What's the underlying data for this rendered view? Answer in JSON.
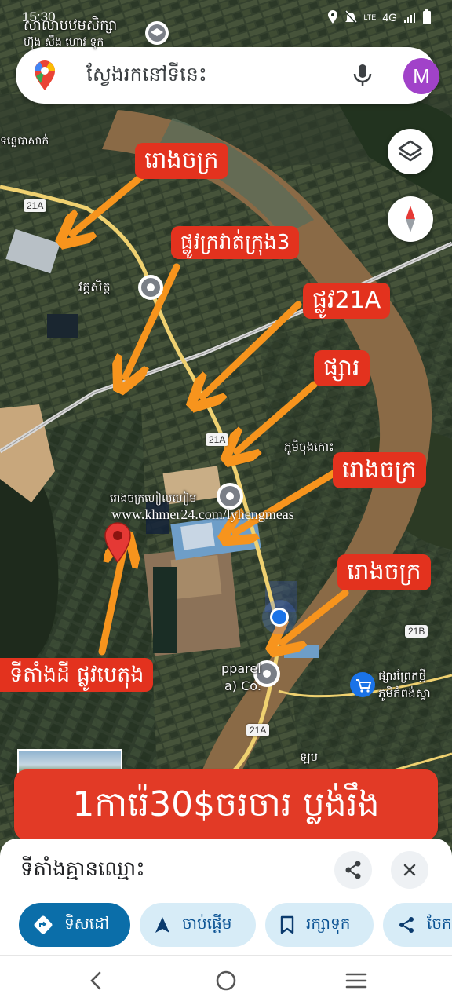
{
  "status_bar": {
    "time": "15:30",
    "network": "4G",
    "lte": "LTE"
  },
  "search": {
    "placeholder": "ស្វែងរកនៅទីនេះ",
    "avatar_letter": "M",
    "icons": [
      "maps-pin-icon",
      "mic-icon"
    ]
  },
  "map": {
    "callouts": {
      "factory_top": "រោងចក្រ",
      "road_3": "ផ្លូវក្រវាត់ក្រុង3",
      "road_21a": "ផ្លូវ21A",
      "market": "ផ្សារ",
      "factory_mid": "រោងចក្រ",
      "factory_low": "រោងចក្រ",
      "land": "ទីតាំងដី ផ្លូវបេតុង"
    },
    "labels": {
      "school": "សាលាបឋមសិក្សា",
      "school_sub": "ហ៊ុង សឹង ហោវ ទុក",
      "river": "ទន្លេបាសាក់",
      "pagoda": "វត្តសិត្ត",
      "village": "ភូមិចុងកោះ",
      "factory_name": "រោងចក្រហៀលហៀម",
      "apparel": "pparel",
      "apparel_sub": "a) Co.",
      "market_name": "ផ្សារព្រែកថ្មី",
      "market_sub": "ភូមិកំពង់ស្វា",
      "partial": "ឡប"
    },
    "roads": [
      "21A",
      "21A",
      "21A",
      "21B"
    ],
    "watermark": "www.khmer24.com/lyhengmeas"
  },
  "price_banner": "1ការ៉េ30$ចរចារ ប្លង់រឹង",
  "place": {
    "title": "ទីតាំងគ្មានឈ្មោះ"
  },
  "actions": [
    {
      "label": "ទិសដៅ",
      "icon": "directions-icon"
    },
    {
      "label": "ចាប់ផ្ដើម",
      "icon": "navigation-arrow-icon"
    },
    {
      "label": "រក្សាទុក",
      "icon": "bookmark-icon"
    },
    {
      "label": "ចែក",
      "icon": "share-icon"
    }
  ],
  "colors": {
    "callout_red": "#e3321e",
    "primary_blue": "#0b6ea9",
    "chip_blue": "#d7ecf7",
    "avatar_purple": "#a142c9",
    "arrow_orange": "#f7941d"
  }
}
